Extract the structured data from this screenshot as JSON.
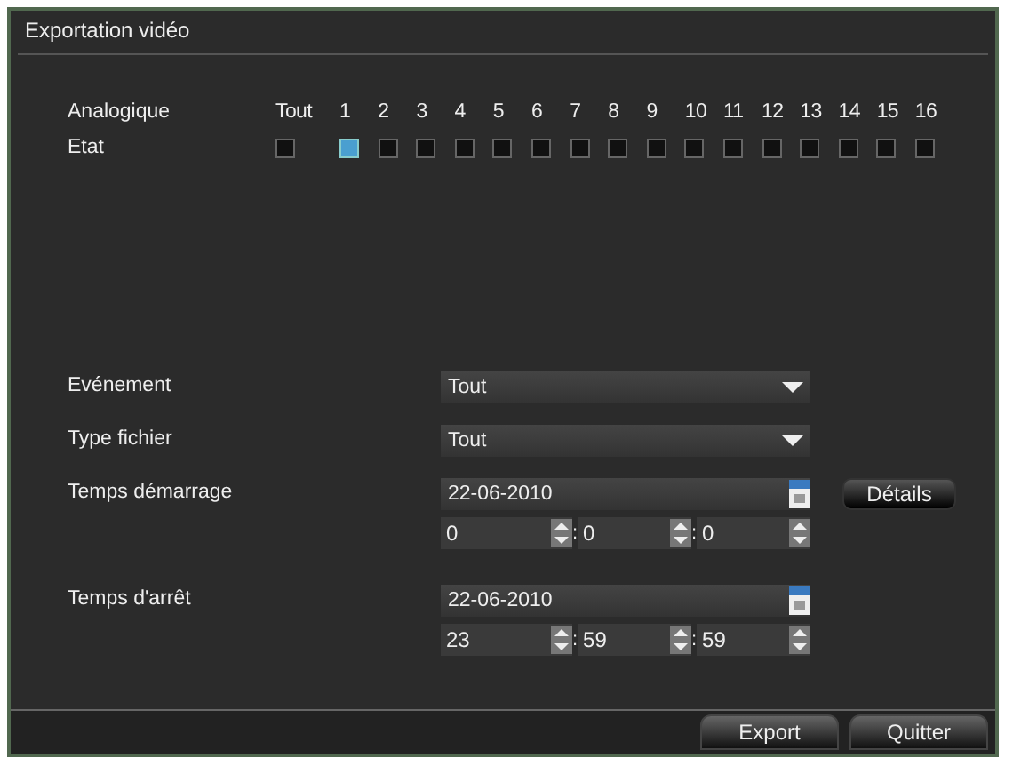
{
  "window": {
    "title": "Exportation vidéo"
  },
  "channels": {
    "row_label": "Analogique",
    "state_label": "Etat",
    "columns": [
      {
        "label": "Tout",
        "checked": false
      },
      {
        "label": "1",
        "checked": true
      },
      {
        "label": "2",
        "checked": false
      },
      {
        "label": "3",
        "checked": false
      },
      {
        "label": "4",
        "checked": false
      },
      {
        "label": "5",
        "checked": false
      },
      {
        "label": "6",
        "checked": false
      },
      {
        "label": "7",
        "checked": false
      },
      {
        "label": "8",
        "checked": false
      },
      {
        "label": "9",
        "checked": false
      },
      {
        "label": "10",
        "checked": false
      },
      {
        "label": "11",
        "checked": false
      },
      {
        "label": "12",
        "checked": false
      },
      {
        "label": "13",
        "checked": false
      },
      {
        "label": "14",
        "checked": false
      },
      {
        "label": "15",
        "checked": false
      },
      {
        "label": "16",
        "checked": false
      }
    ]
  },
  "form": [
    {
      "kind": "dropdown",
      "label": "Evénement",
      "value": "Tout"
    },
    {
      "kind": "dropdown",
      "label": "Type fichier",
      "value": "Tout"
    },
    {
      "kind": "datetime",
      "label": "Temps démarrage",
      "date": "22-06-2010",
      "time": [
        "0",
        "0",
        "0"
      ],
      "separators": [
        ":",
        ":"
      ],
      "button": "Détails"
    },
    {
      "kind": "datetime",
      "label": "Temps d'arrêt",
      "date": "22-06-2010",
      "time": [
        "23",
        "59",
        "59"
      ],
      "separators": [
        ":",
        ":"
      ]
    }
  ],
  "buttons": [
    "Export",
    "Quitter"
  ]
}
